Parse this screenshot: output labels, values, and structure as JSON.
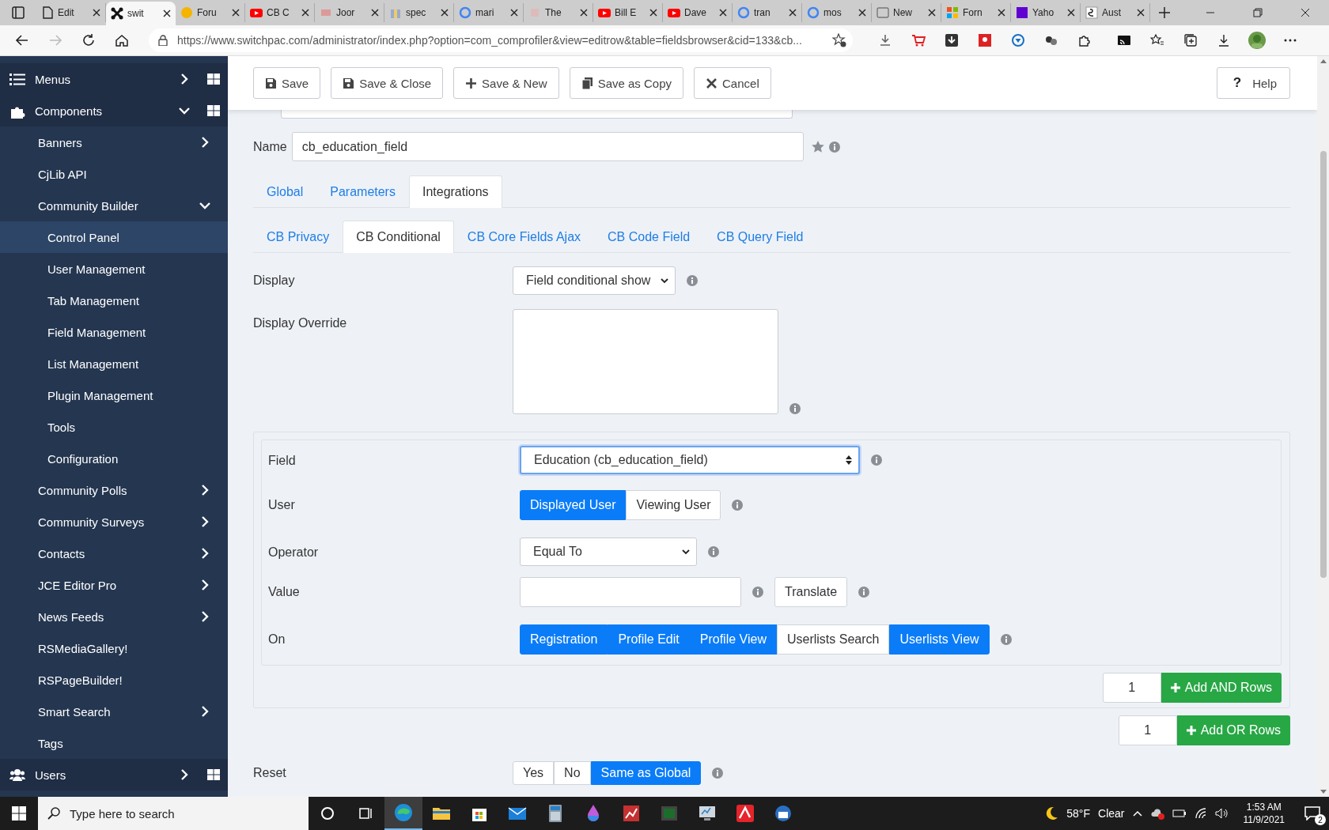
{
  "browser": {
    "tabs": [
      {
        "title": "Edit",
        "selected": false
      },
      {
        "title": "swit",
        "selected": true
      },
      {
        "title": "Foru",
        "selected": false
      },
      {
        "title": "CB C",
        "selected": false
      },
      {
        "title": "Joor",
        "selected": false
      },
      {
        "title": "spec",
        "selected": false
      },
      {
        "title": "mari",
        "selected": false
      },
      {
        "title": "The",
        "selected": false
      },
      {
        "title": "Bill E",
        "selected": false
      },
      {
        "title": "Dave",
        "selected": false
      },
      {
        "title": "tran",
        "selected": false
      },
      {
        "title": "mos",
        "selected": false
      },
      {
        "title": "New",
        "selected": false
      },
      {
        "title": "Forn",
        "selected": false
      },
      {
        "title": "Yaho",
        "selected": false
      },
      {
        "title": "Aust",
        "selected": false
      }
    ],
    "url": "https://www.switchpac.com/administrator/index.php?option=com_comprofiler&view=editrow&table=fieldsbrowser&cid=133&cb..."
  },
  "sidebar": {
    "items": [
      {
        "label": "Menus",
        "expanded": false,
        "selected": false
      },
      {
        "label": "Components",
        "expanded": true,
        "selected": false,
        "children": [
          {
            "label": "Banners",
            "expanded": false,
            "selected": false
          },
          {
            "label": "CjLib API",
            "selected": false
          },
          {
            "label": "Community Builder",
            "expanded": true,
            "selected": false,
            "children": [
              {
                "label": "Control Panel",
                "selected": true
              },
              {
                "label": "User Management",
                "selected": false
              },
              {
                "label": "Tab Management",
                "selected": false
              },
              {
                "label": "Field Management",
                "selected": false
              },
              {
                "label": "List Management",
                "selected": false
              },
              {
                "label": "Plugin Management",
                "selected": false
              },
              {
                "label": "Tools",
                "selected": false
              },
              {
                "label": "Configuration",
                "selected": false
              }
            ]
          },
          {
            "label": "Community Polls",
            "expanded": false,
            "selected": false
          },
          {
            "label": "Community Surveys",
            "expanded": false,
            "selected": false
          },
          {
            "label": "Contacts",
            "expanded": false,
            "selected": false
          },
          {
            "label": "JCE Editor Pro",
            "expanded": false,
            "selected": false
          },
          {
            "label": "News Feeds",
            "expanded": false,
            "selected": false
          },
          {
            "label": "RSMediaGallery!",
            "selected": false
          },
          {
            "label": "RSPageBuilder!",
            "selected": false
          },
          {
            "label": "Smart Search",
            "expanded": false,
            "selected": false
          },
          {
            "label": "Tags",
            "selected": false
          }
        ]
      },
      {
        "label": "Users",
        "expanded": false,
        "selected": false
      }
    ]
  },
  "toolbar": {
    "buttons": [
      "Save",
      "Save & Close",
      "Save & New",
      "Save as Copy",
      "Cancel"
    ],
    "help_icon": "?",
    "help": "Help"
  },
  "name_field": {
    "label": "Name",
    "value": "cb_education_field"
  },
  "tabs": [
    {
      "label": "Global",
      "selected": false
    },
    {
      "label": "Parameters",
      "selected": false
    },
    {
      "label": "Integrations",
      "selected": true
    }
  ],
  "subtabs": [
    {
      "label": "CB Privacy",
      "selected": false
    },
    {
      "label": "CB Conditional",
      "selected": true
    },
    {
      "label": "CB Core Fields Ajax",
      "selected": false
    },
    {
      "label": "CB Code Field",
      "selected": false
    },
    {
      "label": "CB Query Field",
      "selected": false
    }
  ],
  "fields": [
    {
      "kind": "select",
      "label": "Display",
      "value": "Field conditional show",
      "focused": false
    },
    {
      "kind": "textarea",
      "label": "Display Override"
    }
  ],
  "condition": {
    "rows": [
      {
        "kind": "picker",
        "label": "Field",
        "value": "Education (cb_education_field)",
        "focused": true
      },
      {
        "kind": "segmented",
        "label": "User",
        "options": [
          {
            "label": "Displayed User",
            "selected": true
          },
          {
            "label": "Viewing User",
            "selected": false
          }
        ]
      },
      {
        "kind": "select",
        "label": "Operator",
        "value": "Equal To",
        "focused": false
      },
      {
        "kind": "text",
        "label": "Value",
        "button": "Translate"
      },
      {
        "kind": "segmented",
        "label": "On",
        "options": [
          {
            "label": "Registration",
            "selected": true
          },
          {
            "label": "Profile Edit",
            "selected": true
          },
          {
            "label": "Profile View",
            "selected": true
          },
          {
            "label": "Userlists Search",
            "selected": false
          },
          {
            "label": "Userlists View",
            "selected": true
          }
        ]
      }
    ],
    "add_and": {
      "count": "1",
      "button": "Add AND Rows"
    },
    "add_or": {
      "count": "1",
      "button": "Add OR Rows"
    }
  },
  "reset": {
    "label": "Reset",
    "options": [
      {
        "label": "Yes",
        "selected": false
      },
      {
        "label": "No",
        "selected": false
      },
      {
        "label": "Same as Global",
        "selected": true
      }
    ]
  },
  "taskbar": {
    "search_placeholder": "Type here to search",
    "apps": [
      {
        "active": true
      },
      {
        "active": false
      },
      {
        "active": false
      },
      {
        "active": false
      },
      {
        "active": false
      },
      {
        "active": false
      },
      {
        "active": false
      },
      {
        "active": false
      },
      {
        "active": false
      },
      {
        "active": false
      },
      {
        "active": false
      }
    ],
    "temperature": "58°F",
    "weather": "Clear",
    "time": "1:53 AM",
    "date": "11/9/2021",
    "notifications": "2"
  }
}
